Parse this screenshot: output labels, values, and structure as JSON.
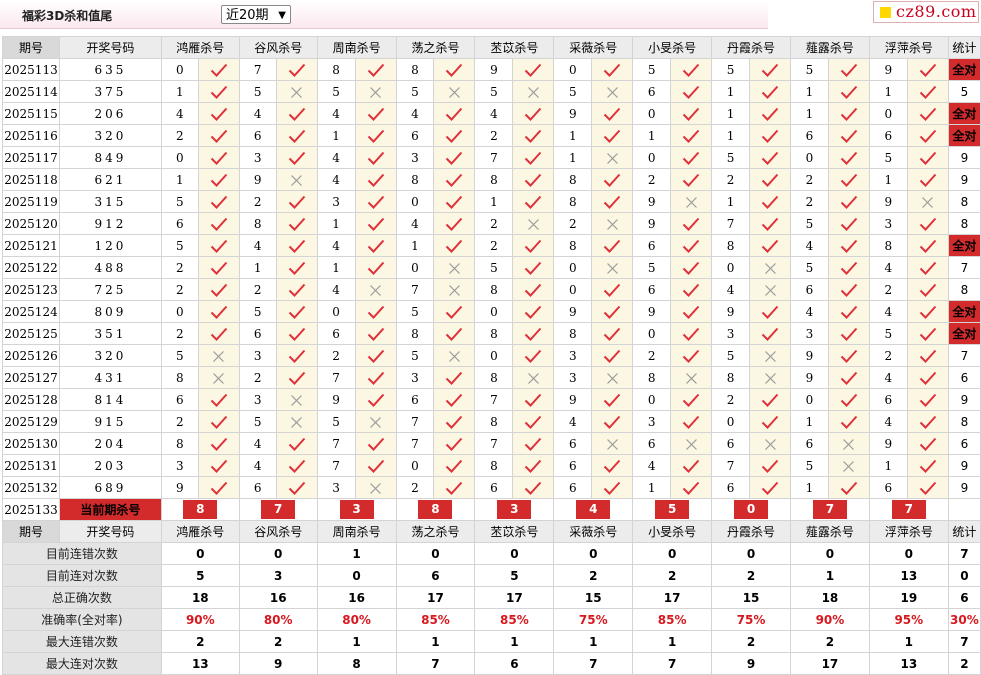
{
  "header": {
    "title": "福彩3D杀和值尾",
    "period_select": "近20期",
    "logo_text": "cz89.com"
  },
  "columns": [
    "期号",
    "开奖号码",
    "鸿雁杀号",
    "谷风杀号",
    "周南杀号",
    "荡之杀号",
    "苤苡杀号",
    "采薇杀号",
    "小旻杀号",
    "丹霞杀号",
    "薤露杀号",
    "浮萍杀号",
    "统计"
  ],
  "rows": [
    {
      "issue": "2025113",
      "draw": "635",
      "kills": [
        [
          "0",
          1
        ],
        [
          "7",
          1
        ],
        [
          "8",
          1
        ],
        [
          "8",
          1
        ],
        [
          "9",
          1
        ],
        [
          "0",
          1
        ],
        [
          "5",
          1
        ],
        [
          "5",
          1
        ],
        [
          "5",
          1
        ],
        [
          "9",
          1
        ]
      ],
      "stat": "全对"
    },
    {
      "issue": "2025114",
      "draw": "375",
      "kills": [
        [
          "1",
          1
        ],
        [
          "5",
          0
        ],
        [
          "5",
          0
        ],
        [
          "5",
          0
        ],
        [
          "5",
          0
        ],
        [
          "5",
          0
        ],
        [
          "6",
          1
        ],
        [
          "1",
          1
        ],
        [
          "1",
          1
        ],
        [
          "1",
          1
        ]
      ],
      "stat": "5"
    },
    {
      "issue": "2025115",
      "draw": "206",
      "kills": [
        [
          "4",
          1
        ],
        [
          "4",
          1
        ],
        [
          "4",
          1
        ],
        [
          "4",
          1
        ],
        [
          "4",
          1
        ],
        [
          "9",
          1
        ],
        [
          "0",
          1
        ],
        [
          "1",
          1
        ],
        [
          "1",
          1
        ],
        [
          "0",
          1
        ]
      ],
      "stat": "全对"
    },
    {
      "issue": "2025116",
      "draw": "320",
      "kills": [
        [
          "2",
          1
        ],
        [
          "6",
          1
        ],
        [
          "1",
          1
        ],
        [
          "6",
          1
        ],
        [
          "2",
          1
        ],
        [
          "1",
          1
        ],
        [
          "1",
          1
        ],
        [
          "1",
          1
        ],
        [
          "6",
          1
        ],
        [
          "6",
          1
        ]
      ],
      "stat": "全对"
    },
    {
      "issue": "2025117",
      "draw": "849",
      "kills": [
        [
          "0",
          1
        ],
        [
          "3",
          1
        ],
        [
          "4",
          1
        ],
        [
          "3",
          1
        ],
        [
          "7",
          1
        ],
        [
          "1",
          0
        ],
        [
          "0",
          1
        ],
        [
          "5",
          1
        ],
        [
          "0",
          1
        ],
        [
          "5",
          1
        ]
      ],
      "stat": "9"
    },
    {
      "issue": "2025118",
      "draw": "621",
      "kills": [
        [
          "1",
          1
        ],
        [
          "9",
          0
        ],
        [
          "4",
          1
        ],
        [
          "8",
          1
        ],
        [
          "8",
          1
        ],
        [
          "8",
          1
        ],
        [
          "2",
          1
        ],
        [
          "2",
          1
        ],
        [
          "2",
          1
        ],
        [
          "1",
          1
        ]
      ],
      "stat": "9"
    },
    {
      "issue": "2025119",
      "draw": "315",
      "kills": [
        [
          "5",
          1
        ],
        [
          "2",
          1
        ],
        [
          "3",
          1
        ],
        [
          "0",
          1
        ],
        [
          "1",
          1
        ],
        [
          "8",
          1
        ],
        [
          "9",
          0
        ],
        [
          "1",
          1
        ],
        [
          "2",
          1
        ],
        [
          "9",
          0
        ]
      ],
      "stat": "8"
    },
    {
      "issue": "2025120",
      "draw": "912",
      "kills": [
        [
          "6",
          1
        ],
        [
          "8",
          1
        ],
        [
          "1",
          1
        ],
        [
          "4",
          1
        ],
        [
          "2",
          0
        ],
        [
          "2",
          0
        ],
        [
          "9",
          1
        ],
        [
          "7",
          1
        ],
        [
          "5",
          1
        ],
        [
          "3",
          1
        ]
      ],
      "stat": "8"
    },
    {
      "issue": "2025121",
      "draw": "120",
      "kills": [
        [
          "5",
          1
        ],
        [
          "4",
          1
        ],
        [
          "4",
          1
        ],
        [
          "1",
          1
        ],
        [
          "2",
          1
        ],
        [
          "8",
          1
        ],
        [
          "6",
          1
        ],
        [
          "8",
          1
        ],
        [
          "4",
          1
        ],
        [
          "8",
          1
        ]
      ],
      "stat": "全对"
    },
    {
      "issue": "2025122",
      "draw": "488",
      "kills": [
        [
          "2",
          1
        ],
        [
          "1",
          1
        ],
        [
          "1",
          1
        ],
        [
          "0",
          0
        ],
        [
          "5",
          1
        ],
        [
          "0",
          0
        ],
        [
          "5",
          1
        ],
        [
          "0",
          0
        ],
        [
          "5",
          1
        ],
        [
          "4",
          1
        ]
      ],
      "stat": "7"
    },
    {
      "issue": "2025123",
      "draw": "725",
      "kills": [
        [
          "2",
          1
        ],
        [
          "2",
          1
        ],
        [
          "4",
          0
        ],
        [
          "7",
          0
        ],
        [
          "8",
          1
        ],
        [
          "0",
          1
        ],
        [
          "6",
          1
        ],
        [
          "4",
          0
        ],
        [
          "6",
          1
        ],
        [
          "2",
          1
        ]
      ],
      "stat": "8"
    },
    {
      "issue": "2025124",
      "draw": "809",
      "kills": [
        [
          "0",
          1
        ],
        [
          "5",
          1
        ],
        [
          "0",
          1
        ],
        [
          "5",
          1
        ],
        [
          "0",
          1
        ],
        [
          "9",
          1
        ],
        [
          "9",
          1
        ],
        [
          "9",
          1
        ],
        [
          "4",
          1
        ],
        [
          "4",
          1
        ]
      ],
      "stat": "全对"
    },
    {
      "issue": "2025125",
      "draw": "351",
      "kills": [
        [
          "2",
          1
        ],
        [
          "6",
          1
        ],
        [
          "6",
          1
        ],
        [
          "8",
          1
        ],
        [
          "8",
          1
        ],
        [
          "8",
          1
        ],
        [
          "0",
          1
        ],
        [
          "3",
          1
        ],
        [
          "3",
          1
        ],
        [
          "5",
          1
        ]
      ],
      "stat": "全对"
    },
    {
      "issue": "2025126",
      "draw": "320",
      "kills": [
        [
          "5",
          0
        ],
        [
          "3",
          1
        ],
        [
          "2",
          1
        ],
        [
          "5",
          0
        ],
        [
          "0",
          1
        ],
        [
          "3",
          1
        ],
        [
          "2",
          1
        ],
        [
          "5",
          0
        ],
        [
          "9",
          1
        ],
        [
          "2",
          1
        ]
      ],
      "stat": "7"
    },
    {
      "issue": "2025127",
      "draw": "431",
      "kills": [
        [
          "8",
          0
        ],
        [
          "2",
          1
        ],
        [
          "7",
          1
        ],
        [
          "3",
          1
        ],
        [
          "8",
          0
        ],
        [
          "3",
          0
        ],
        [
          "8",
          0
        ],
        [
          "8",
          0
        ],
        [
          "9",
          1
        ],
        [
          "4",
          1
        ]
      ],
      "stat": "6"
    },
    {
      "issue": "2025128",
      "draw": "814",
      "kills": [
        [
          "6",
          1
        ],
        [
          "3",
          0
        ],
        [
          "9",
          1
        ],
        [
          "6",
          1
        ],
        [
          "7",
          1
        ],
        [
          "9",
          1
        ],
        [
          "0",
          1
        ],
        [
          "2",
          1
        ],
        [
          "0",
          1
        ],
        [
          "6",
          1
        ]
      ],
      "stat": "9"
    },
    {
      "issue": "2025129",
      "draw": "915",
      "kills": [
        [
          "2",
          1
        ],
        [
          "5",
          0
        ],
        [
          "5",
          0
        ],
        [
          "7",
          1
        ],
        [
          "8",
          1
        ],
        [
          "4",
          1
        ],
        [
          "3",
          1
        ],
        [
          "0",
          1
        ],
        [
          "1",
          1
        ],
        [
          "4",
          1
        ]
      ],
      "stat": "8"
    },
    {
      "issue": "2025130",
      "draw": "204",
      "kills": [
        [
          "8",
          1
        ],
        [
          "4",
          1
        ],
        [
          "7",
          1
        ],
        [
          "7",
          1
        ],
        [
          "7",
          1
        ],
        [
          "6",
          0
        ],
        [
          "6",
          0
        ],
        [
          "6",
          0
        ],
        [
          "6",
          0
        ],
        [
          "9",
          1
        ]
      ],
      "stat": "6"
    },
    {
      "issue": "2025131",
      "draw": "203",
      "kills": [
        [
          "3",
          1
        ],
        [
          "4",
          1
        ],
        [
          "7",
          1
        ],
        [
          "0",
          1
        ],
        [
          "8",
          1
        ],
        [
          "6",
          1
        ],
        [
          "4",
          1
        ],
        [
          "7",
          1
        ],
        [
          "5",
          0
        ],
        [
          "1",
          1
        ]
      ],
      "stat": "9"
    },
    {
      "issue": "2025132",
      "draw": "689",
      "kills": [
        [
          "9",
          1
        ],
        [
          "6",
          1
        ],
        [
          "3",
          0
        ],
        [
          "2",
          1
        ],
        [
          "6",
          1
        ],
        [
          "6",
          1
        ],
        [
          "1",
          1
        ],
        [
          "6",
          1
        ],
        [
          "1",
          1
        ],
        [
          "6",
          1
        ]
      ],
      "stat": "9"
    }
  ],
  "current": {
    "issue": "2025133",
    "label": "当前期杀号",
    "kills": [
      "8",
      "7",
      "3",
      "8",
      "3",
      "4",
      "5",
      "0",
      "7",
      "7"
    ]
  },
  "summary": [
    {
      "label": "目前连错次数",
      "values": [
        "0",
        "0",
        "1",
        "0",
        "0",
        "0",
        "0",
        "0",
        "0",
        "0",
        "7"
      ],
      "red": false
    },
    {
      "label": "目前连对次数",
      "values": [
        "5",
        "3",
        "0",
        "6",
        "5",
        "2",
        "2",
        "2",
        "1",
        "13",
        "0"
      ],
      "red": false
    },
    {
      "label": "总正确次数",
      "values": [
        "18",
        "16",
        "16",
        "17",
        "17",
        "15",
        "17",
        "15",
        "18",
        "19",
        "6"
      ],
      "red": false
    },
    {
      "label": "准确率(全对率)",
      "values": [
        "90%",
        "80%",
        "80%",
        "85%",
        "85%",
        "75%",
        "85%",
        "75%",
        "90%",
        "95%",
        "30%"
      ],
      "red": true
    },
    {
      "label": "最大连错次数",
      "values": [
        "2",
        "2",
        "1",
        "1",
        "1",
        "1",
        "1",
        "2",
        "2",
        "1",
        "7"
      ],
      "red": false
    },
    {
      "label": "最大连对次数",
      "values": [
        "13",
        "9",
        "8",
        "7",
        "6",
        "7",
        "7",
        "9",
        "17",
        "13",
        "2"
      ],
      "red": false
    }
  ]
}
